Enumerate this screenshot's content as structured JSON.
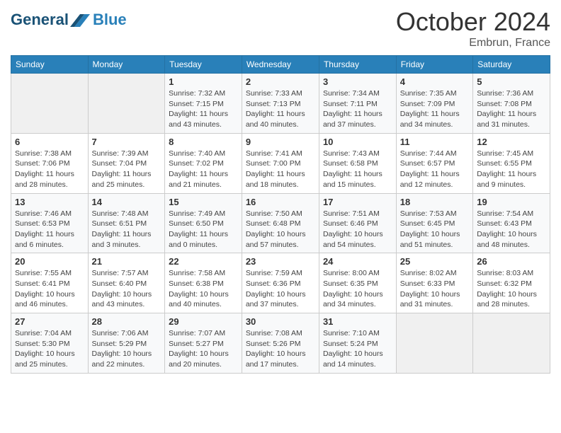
{
  "header": {
    "logo_line1": "General",
    "logo_line2": "Blue",
    "month": "October 2024",
    "location": "Embrun, France"
  },
  "weekdays": [
    "Sunday",
    "Monday",
    "Tuesday",
    "Wednesday",
    "Thursday",
    "Friday",
    "Saturday"
  ],
  "weeks": [
    [
      {
        "day": "",
        "info": ""
      },
      {
        "day": "",
        "info": ""
      },
      {
        "day": "1",
        "info": "Sunrise: 7:32 AM\nSunset: 7:15 PM\nDaylight: 11 hours and 43 minutes."
      },
      {
        "day": "2",
        "info": "Sunrise: 7:33 AM\nSunset: 7:13 PM\nDaylight: 11 hours and 40 minutes."
      },
      {
        "day": "3",
        "info": "Sunrise: 7:34 AM\nSunset: 7:11 PM\nDaylight: 11 hours and 37 minutes."
      },
      {
        "day": "4",
        "info": "Sunrise: 7:35 AM\nSunset: 7:09 PM\nDaylight: 11 hours and 34 minutes."
      },
      {
        "day": "5",
        "info": "Sunrise: 7:36 AM\nSunset: 7:08 PM\nDaylight: 11 hours and 31 minutes."
      }
    ],
    [
      {
        "day": "6",
        "info": "Sunrise: 7:38 AM\nSunset: 7:06 PM\nDaylight: 11 hours and 28 minutes."
      },
      {
        "day": "7",
        "info": "Sunrise: 7:39 AM\nSunset: 7:04 PM\nDaylight: 11 hours and 25 minutes."
      },
      {
        "day": "8",
        "info": "Sunrise: 7:40 AM\nSunset: 7:02 PM\nDaylight: 11 hours and 21 minutes."
      },
      {
        "day": "9",
        "info": "Sunrise: 7:41 AM\nSunset: 7:00 PM\nDaylight: 11 hours and 18 minutes."
      },
      {
        "day": "10",
        "info": "Sunrise: 7:43 AM\nSunset: 6:58 PM\nDaylight: 11 hours and 15 minutes."
      },
      {
        "day": "11",
        "info": "Sunrise: 7:44 AM\nSunset: 6:57 PM\nDaylight: 11 hours and 12 minutes."
      },
      {
        "day": "12",
        "info": "Sunrise: 7:45 AM\nSunset: 6:55 PM\nDaylight: 11 hours and 9 minutes."
      }
    ],
    [
      {
        "day": "13",
        "info": "Sunrise: 7:46 AM\nSunset: 6:53 PM\nDaylight: 11 hours and 6 minutes."
      },
      {
        "day": "14",
        "info": "Sunrise: 7:48 AM\nSunset: 6:51 PM\nDaylight: 11 hours and 3 minutes."
      },
      {
        "day": "15",
        "info": "Sunrise: 7:49 AM\nSunset: 6:50 PM\nDaylight: 11 hours and 0 minutes."
      },
      {
        "day": "16",
        "info": "Sunrise: 7:50 AM\nSunset: 6:48 PM\nDaylight: 10 hours and 57 minutes."
      },
      {
        "day": "17",
        "info": "Sunrise: 7:51 AM\nSunset: 6:46 PM\nDaylight: 10 hours and 54 minutes."
      },
      {
        "day": "18",
        "info": "Sunrise: 7:53 AM\nSunset: 6:45 PM\nDaylight: 10 hours and 51 minutes."
      },
      {
        "day": "19",
        "info": "Sunrise: 7:54 AM\nSunset: 6:43 PM\nDaylight: 10 hours and 48 minutes."
      }
    ],
    [
      {
        "day": "20",
        "info": "Sunrise: 7:55 AM\nSunset: 6:41 PM\nDaylight: 10 hours and 46 minutes."
      },
      {
        "day": "21",
        "info": "Sunrise: 7:57 AM\nSunset: 6:40 PM\nDaylight: 10 hours and 43 minutes."
      },
      {
        "day": "22",
        "info": "Sunrise: 7:58 AM\nSunset: 6:38 PM\nDaylight: 10 hours and 40 minutes."
      },
      {
        "day": "23",
        "info": "Sunrise: 7:59 AM\nSunset: 6:36 PM\nDaylight: 10 hours and 37 minutes."
      },
      {
        "day": "24",
        "info": "Sunrise: 8:00 AM\nSunset: 6:35 PM\nDaylight: 10 hours and 34 minutes."
      },
      {
        "day": "25",
        "info": "Sunrise: 8:02 AM\nSunset: 6:33 PM\nDaylight: 10 hours and 31 minutes."
      },
      {
        "day": "26",
        "info": "Sunrise: 8:03 AM\nSunset: 6:32 PM\nDaylight: 10 hours and 28 minutes."
      }
    ],
    [
      {
        "day": "27",
        "info": "Sunrise: 7:04 AM\nSunset: 5:30 PM\nDaylight: 10 hours and 25 minutes."
      },
      {
        "day": "28",
        "info": "Sunrise: 7:06 AM\nSunset: 5:29 PM\nDaylight: 10 hours and 22 minutes."
      },
      {
        "day": "29",
        "info": "Sunrise: 7:07 AM\nSunset: 5:27 PM\nDaylight: 10 hours and 20 minutes."
      },
      {
        "day": "30",
        "info": "Sunrise: 7:08 AM\nSunset: 5:26 PM\nDaylight: 10 hours and 17 minutes."
      },
      {
        "day": "31",
        "info": "Sunrise: 7:10 AM\nSunset: 5:24 PM\nDaylight: 10 hours and 14 minutes."
      },
      {
        "day": "",
        "info": ""
      },
      {
        "day": "",
        "info": ""
      }
    ]
  ]
}
